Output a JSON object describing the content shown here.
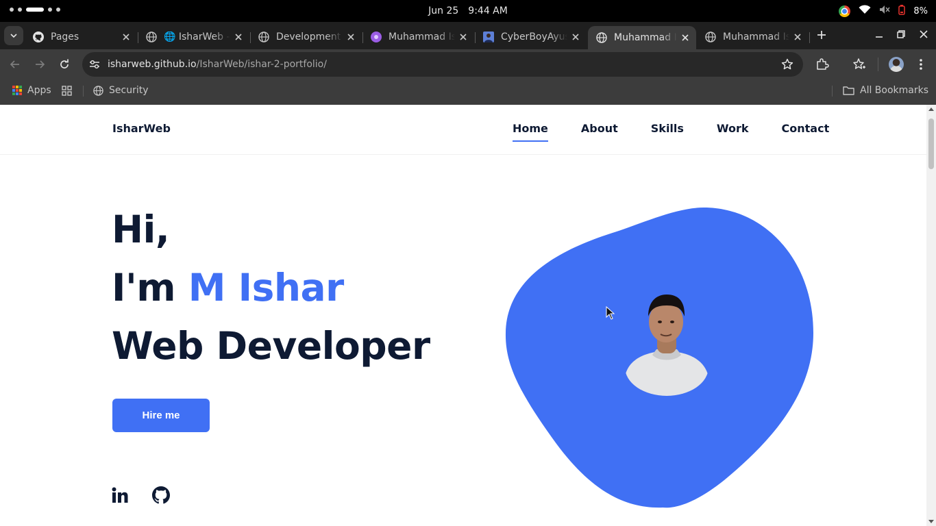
{
  "os": {
    "date": "Jun 25",
    "time": "9:44 AM",
    "battery": "8%"
  },
  "tabs": [
    {
      "title": "Pages",
      "icon": "github-icon",
      "active": false
    },
    {
      "title": "🌐 IsharWeb - Free",
      "icon": "globe-icon",
      "active": false
    },
    {
      "title": "Development",
      "icon": "globe-icon",
      "active": false
    },
    {
      "title": "Muhammad Ishar",
      "icon": "purple-circle-icon",
      "active": false
    },
    {
      "title": "CyberBoyAyush",
      "icon": "avatar-icon",
      "active": false
    },
    {
      "title": "Muhammad Ishar",
      "icon": "globe-icon",
      "active": true
    },
    {
      "title": "Muhammad Ishar",
      "icon": "globe-icon",
      "active": false
    }
  ],
  "address_bar": {
    "host": "isharweb.github.io",
    "path": "/IsharWeb/ishar-2-portfolio/"
  },
  "bookmarks": {
    "apps_label": "Apps",
    "security_label": "Security",
    "all_bookmarks_label": "All Bookmarks"
  },
  "site": {
    "logo": "IsharWeb",
    "nav": [
      "Home",
      "About",
      "Skills",
      "Work",
      "Contact"
    ],
    "active_nav": "Home",
    "hero": {
      "line1": "Hi,",
      "line2_prefix": "I'm ",
      "line2_name": "M Ishar",
      "line3": "Web Developer"
    },
    "cta_label": "Hire me",
    "social": [
      "linkedin-icon",
      "github-icon"
    ]
  },
  "colors": {
    "accent": "#4070f4",
    "heading": "#0e1a33",
    "chrome_dark": "#1f1f1f",
    "chrome_toolbar": "#3c3c3c"
  }
}
